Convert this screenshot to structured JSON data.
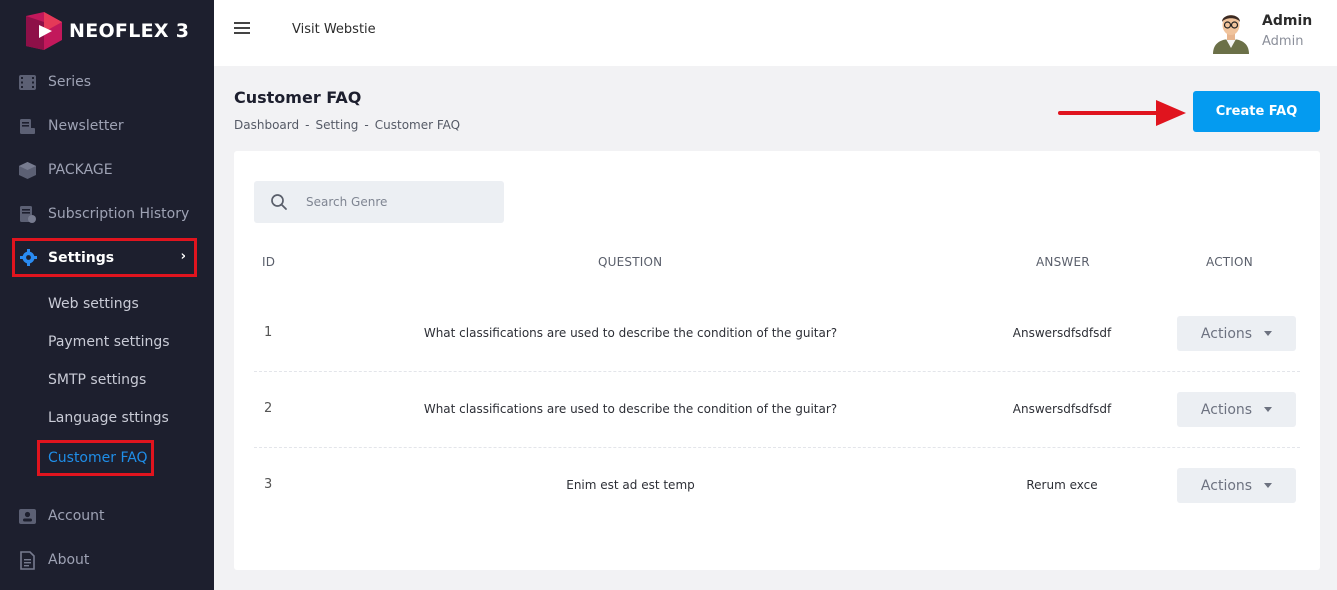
{
  "brand": {
    "name": "NEOFLEX 3"
  },
  "sidebar": {
    "items": [
      {
        "label": "Series",
        "icon": "film-icon"
      },
      {
        "label": "Newsletter",
        "icon": "newsletter-icon"
      },
      {
        "label": "PACKAGE",
        "icon": "package-icon"
      },
      {
        "label": "Subscription History",
        "icon": "history-icon"
      }
    ],
    "settings": {
      "label": "Settings",
      "icon": "gear-icon",
      "chevron": "›"
    },
    "sub_items": [
      "Web settings",
      "Payment settings",
      "SMTP settings",
      "Language sttings"
    ],
    "active_sub": "Customer FAQ",
    "bottom_items": [
      {
        "label": "Account",
        "icon": "account-icon"
      },
      {
        "label": "About",
        "icon": "document-icon"
      }
    ]
  },
  "topbar": {
    "visit_link": "Visit Webstie",
    "user_name": "Admin",
    "user_role": "Admin"
  },
  "page": {
    "title": "Customer FAQ",
    "breadcrumb": [
      "Dashboard",
      "-",
      "Setting",
      "-",
      "Customer FAQ"
    ],
    "create_button": "Create FAQ"
  },
  "search": {
    "placeholder": "Search Genre"
  },
  "table": {
    "headers": {
      "id": "ID",
      "question": "QUESTION",
      "answer": "ANSWER",
      "action": "ACTION"
    },
    "rows": [
      {
        "id": "1",
        "question": "What classifications are used to describe the condition of the guitar?",
        "answer": "Answersdfsdfsdf",
        "action": "Actions"
      },
      {
        "id": "2",
        "question": "What classifications are used to describe the condition of the guitar?",
        "answer": "Answersdfsdfsdf",
        "action": "Actions"
      },
      {
        "id": "3",
        "question": "Enim est ad est temp",
        "answer": "Rerum exce",
        "action": "Actions"
      }
    ]
  },
  "colors": {
    "sidebar_bg": "#1d1f2e",
    "accent_blue": "#049bf0",
    "highlight_red": "#e0141e",
    "active_link": "#1f8ee8"
  }
}
